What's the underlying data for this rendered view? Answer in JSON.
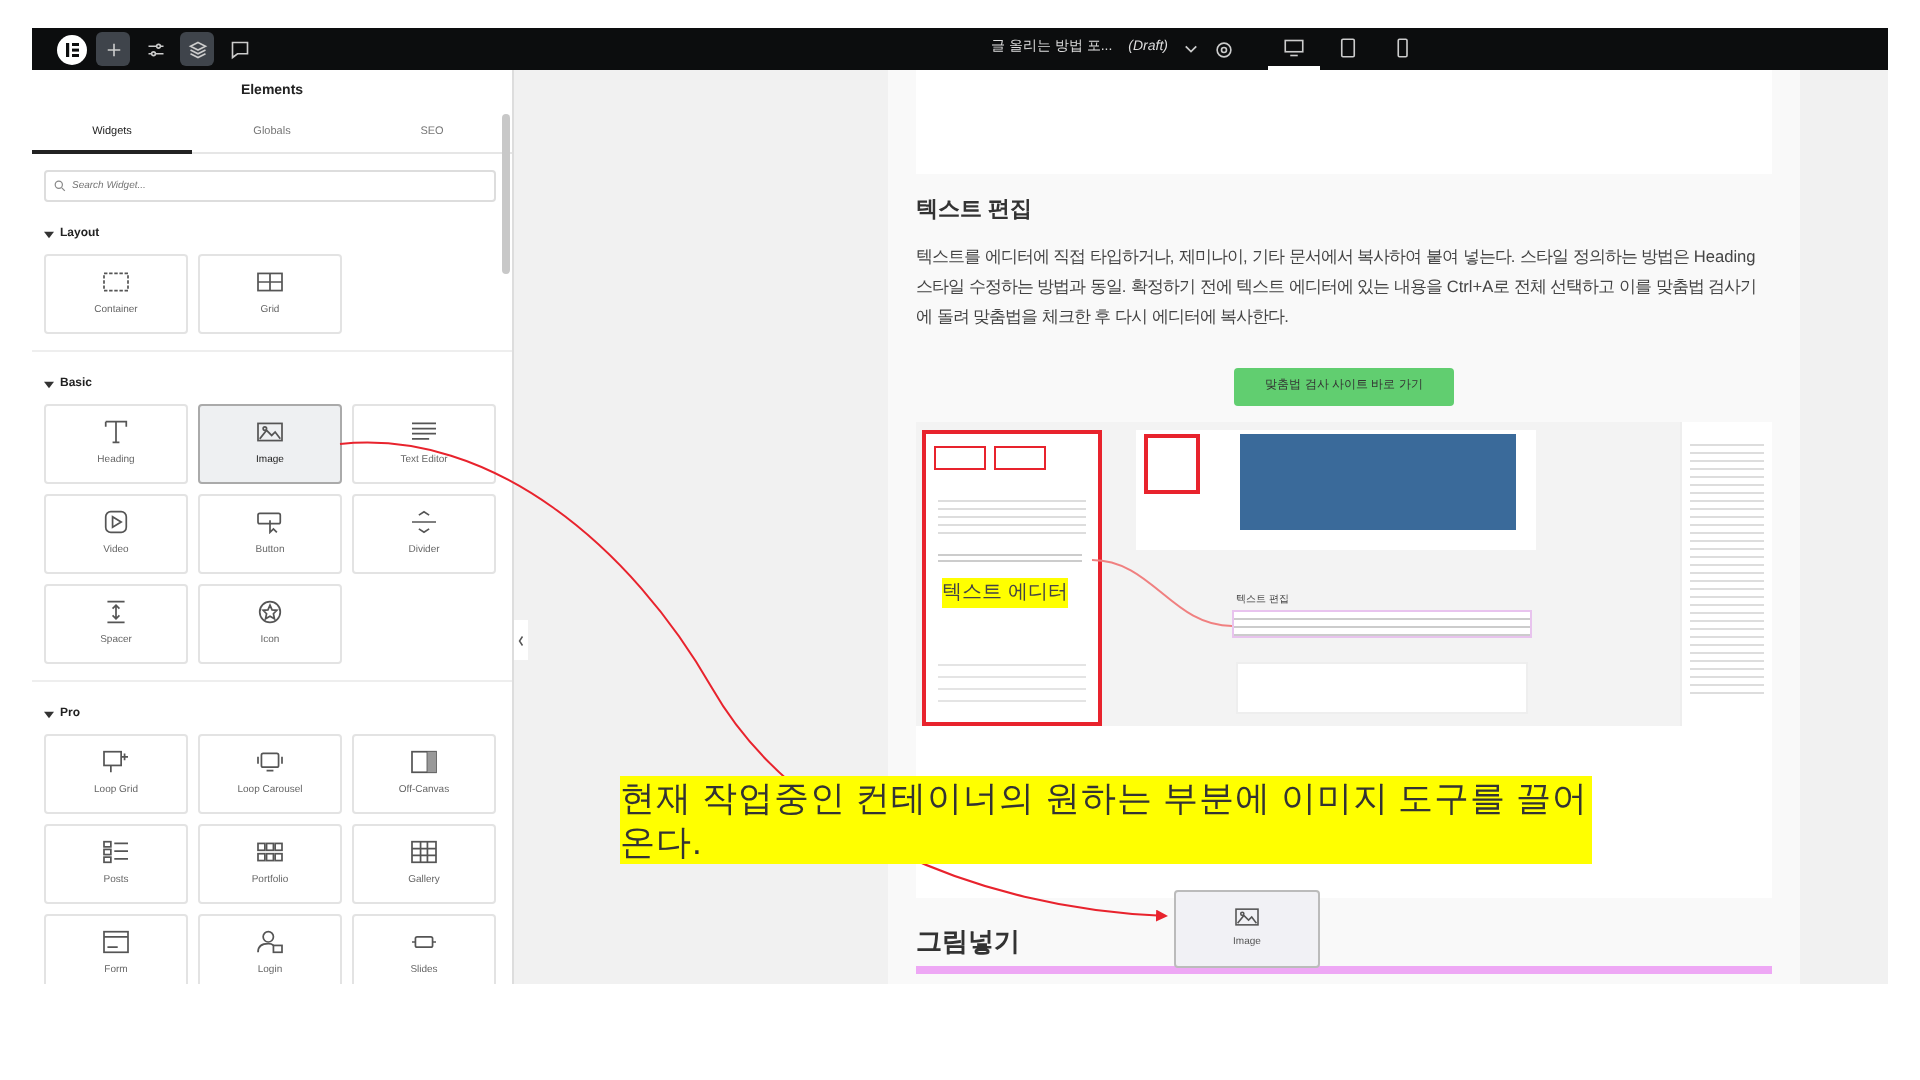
{
  "top_bar": {
    "tools": [
      {
        "kind": "logo",
        "selected": false
      },
      {
        "kind": "add",
        "selected": true
      },
      {
        "kind": "sliders",
        "selected": false
      },
      {
        "kind": "layers",
        "selected": true
      },
      {
        "kind": "chat",
        "selected": false
      }
    ],
    "page_title": "글 올리는 방법 포...",
    "status": "(Draft)",
    "devices": [
      {
        "kind": "desktop",
        "selected": true
      },
      {
        "kind": "tablet",
        "selected": false
      },
      {
        "kind": "mobile",
        "selected": false
      }
    ]
  },
  "panel": {
    "title": "Elements",
    "tabs": [
      {
        "label": "Widgets",
        "selected": true
      },
      {
        "label": "Globals",
        "selected": false
      },
      {
        "label": "SEO",
        "selected": false
      }
    ],
    "search": {
      "placeholder": "Search Widget..."
    },
    "sections": [
      {
        "title": "Layout",
        "expanded": true,
        "widgets": [
          {
            "label": "Container",
            "kind": "container",
            "selected": false
          },
          {
            "label": "Grid",
            "kind": "grid",
            "selected": false
          }
        ]
      },
      {
        "title": "Basic",
        "expanded": true,
        "widgets": [
          {
            "label": "Heading",
            "kind": "heading",
            "selected": false
          },
          {
            "label": "Image",
            "kind": "image",
            "selected": true
          },
          {
            "label": "Text Editor",
            "kind": "text",
            "selected": false
          },
          {
            "label": "Video",
            "kind": "video",
            "selected": false
          },
          {
            "label": "Button",
            "kind": "button",
            "selected": false
          },
          {
            "label": "Divider",
            "kind": "divider",
            "selected": false
          },
          {
            "label": "Spacer",
            "kind": "spacer",
            "selected": false
          },
          {
            "label": "Icon",
            "kind": "star",
            "selected": false
          }
        ]
      },
      {
        "title": "Pro",
        "expanded": true,
        "widgets": [
          {
            "label": "Loop Grid",
            "kind": "loopgrid",
            "selected": false
          },
          {
            "label": "Loop Carousel",
            "kind": "carousel",
            "selected": false
          },
          {
            "label": "Off-Canvas",
            "kind": "offcanvas",
            "selected": false
          },
          {
            "label": "Posts",
            "kind": "posts",
            "selected": false
          },
          {
            "label": "Portfolio",
            "kind": "portfolio",
            "selected": false
          },
          {
            "label": "Gallery",
            "kind": "gallery",
            "selected": false
          },
          {
            "label": "Form",
            "kind": "form",
            "selected": false
          },
          {
            "label": "Login",
            "kind": "login",
            "selected": false
          },
          {
            "label": "Slides",
            "kind": "slides",
            "selected": false
          }
        ]
      }
    ]
  },
  "canvas": {
    "heading": "텍스트 편집",
    "paragraph": "텍스트를 에디터에 직접 타입하거나, 제미나이, 기타 문서에서 복사하여 붙여 넣는다. 스타일 정의하는 방법은 Heading 스타일 수정하는 방법과 동일. 확정하기 전에 텍스트 에디터에 있는 내용을 Ctrl+A로 전체 선택하고 이를 맞춤법 검사기에 돌려 맞춤법을 체크한 후 다시 에디터에 복사한다.",
    "button": "맞춤법 검사 사이트 바로 가기",
    "screenshot": {
      "highlight": "텍스트 에디터",
      "inner_heading": "텍스트 편집"
    },
    "heading2": "그림넣기"
  },
  "drag_ghost": {
    "label": "Image"
  },
  "annotation": {
    "text": "현재 작업중인 컨테이너의 원하는 부분에 이미지 도구를 끌어온다."
  }
}
